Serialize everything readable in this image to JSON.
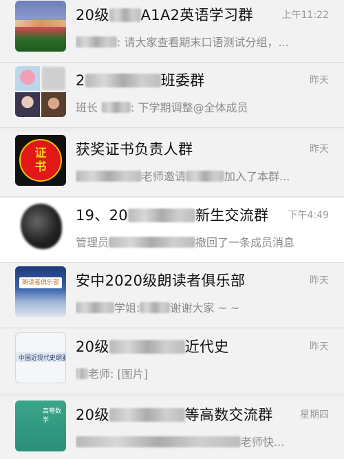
{
  "chats": [
    {
      "avatar": "stadium-photo",
      "title_pre": "20级",
      "title_post": "A1A2英语学习群",
      "time": "上午11:22",
      "preview_pre": "",
      "preview_post": ": 请大家查看期末口语测试分组，..."
    },
    {
      "avatar": "grid-avatar",
      "title_pre": "2",
      "title_post": "班委群",
      "time": "昨天",
      "preview_pre": "班长",
      "preview_post": ": 下学期调整@全体成员"
    },
    {
      "avatar": "certificate-icon",
      "avatar_text": [
        "证",
        "书"
      ],
      "title_pre": "获奖证书负责人群",
      "title_post": "",
      "time": "昨天",
      "preview_pre": "",
      "preview_mid": "老师邀请",
      "preview_post": "加入了本群..."
    },
    {
      "avatar": "blurred-avatar",
      "title_pre": "19、20",
      "title_post": "新生交流群",
      "time": "下午4:49",
      "preview_pre": "管理员",
      "preview_post": "撤回了一条成员消息"
    },
    {
      "avatar": "night-sky-photo",
      "avatar_text": "朗读者俱乐部",
      "title_pre": "安中2020级朗读者俱乐部",
      "title_post": "",
      "time": "昨天",
      "preview_pre": "",
      "preview_mid": "学姐:",
      "preview_post": "谢谢大家 ~ ~"
    },
    {
      "avatar": "book-cover",
      "avatar_text": "中国近现代史纲要",
      "title_pre": "20级",
      "title_post": "近代史",
      "time": "昨天",
      "preview_pre": "",
      "preview_post": "老师: [图片]"
    },
    {
      "avatar": "math-book-cover",
      "avatar_text": "高等数学",
      "title_pre": "20级",
      "title_post": "等高数交流群",
      "time": "星期四",
      "preview_pre": "",
      "preview_post": "老师快..."
    }
  ]
}
